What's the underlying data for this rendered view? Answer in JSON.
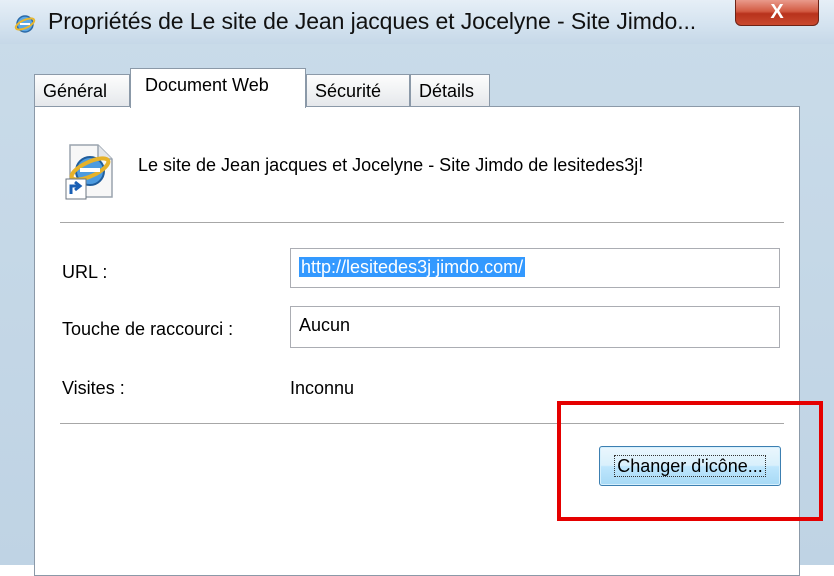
{
  "window": {
    "title": "Propriétés de Le site de Jean jacques et Jocelyne - Site Jimdo...",
    "close_label": "X",
    "icon": "ie-icon"
  },
  "tabs": [
    {
      "label": "Général",
      "active": false
    },
    {
      "label": "Document Web",
      "active": true
    },
    {
      "label": "Sécurité",
      "active": false
    },
    {
      "label": "Détails",
      "active": false
    }
  ],
  "document": {
    "icon": "ie-shortcut-icon",
    "title": "Le site de Jean jacques et Jocelyne - Site Jimdo de lesitedes3j!"
  },
  "fields": {
    "url_label": "URL :",
    "url_value": "http://lesitedes3j.jimdo.com/",
    "shortcut_label": "Touche de raccourci :",
    "shortcut_value": "Aucun",
    "visits_label": "Visites :",
    "visits_value": "Inconnu"
  },
  "buttons": {
    "change_icon": "Changer d'icône..."
  },
  "colors": {
    "highlight": "#e50000",
    "selection": "#3399ff"
  }
}
